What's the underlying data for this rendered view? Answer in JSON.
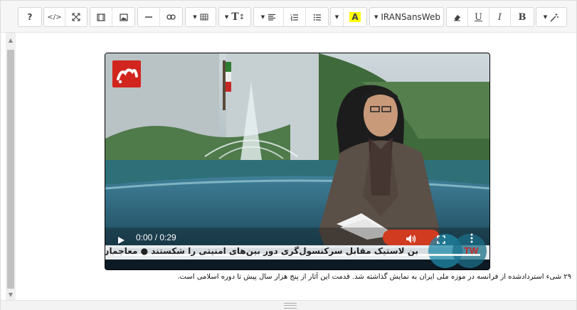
{
  "toolbar": {
    "font_name": "IRANSansWeb",
    "help": "?",
    "code_view": "</>",
    "text_size": "T",
    "bold": "B",
    "italic": "I",
    "underline": "U",
    "font_color": "A",
    "colors": {
      "highlight": "#ffff00"
    }
  },
  "video": {
    "time": "0:00 / 0:29",
    "ticker": "بن لاستیک مقابل سرکنسول‌گری دور بین‌های امنیتی را شکستند  ●  معاجمان با",
    "watermark": "TW"
  },
  "content": {
    "caption": "۲۹ شیء استردادشده از فرانسه در موزه ملی ایران به نمایش گذاشته شد. قدمت این آثار از پنج هزار سال پیش تا دوره اسلامی است."
  }
}
